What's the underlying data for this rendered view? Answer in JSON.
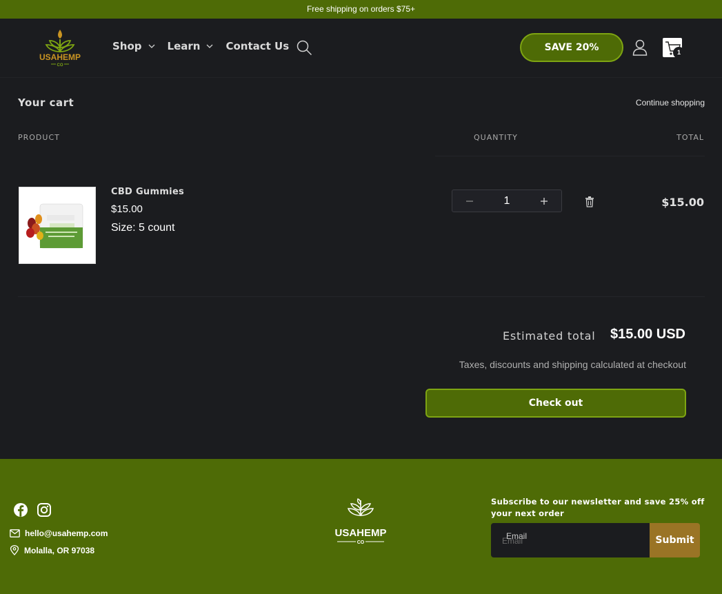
{
  "announcement": {
    "text": "Free shipping on orders $75+"
  },
  "header": {
    "logo_text": "USAHEMP",
    "logo_sub": "CO",
    "nav": [
      {
        "label": "Shop",
        "has_dropdown": true
      },
      {
        "label": "Learn",
        "has_dropdown": true
      },
      {
        "label": "Contact Us",
        "has_dropdown": false
      }
    ],
    "search_icon": "search-icon",
    "save_label": "SAVE 20%",
    "account_icon": "user-icon",
    "cart_icon": "cart-icon",
    "cart_count": "1"
  },
  "cart": {
    "title": "Your cart",
    "continue_label": "Continue shopping",
    "columns": {
      "product": "PRODUCT",
      "quantity": "QUANTITY",
      "total": "TOTAL"
    },
    "items": [
      {
        "name": "CBD Gummies",
        "price": "$15.00",
        "size": "Size: 5 count",
        "quantity": "1",
        "line_total": "$15.00"
      }
    ],
    "estimated_label": "Estimated total",
    "estimated_value": "$15.00 USD",
    "tax_note": "Taxes, discounts and shipping calculated at checkout",
    "checkout_label": "Check out"
  },
  "footer": {
    "email": "hello@usahemp.com",
    "location": "Molalla, OR 97038",
    "logo_text": "USAHEMP",
    "logo_sub": "CO",
    "newsletter_title": "Subscribe to our newsletter and save 25% off your next order",
    "email_label": "Email",
    "email_placeholder": "Email",
    "submit_label": "Submit"
  },
  "colors": {
    "brand_green": "#4e6b06",
    "accent_green_border": "#7ea512",
    "background": "#1b1c1f",
    "submit_gold": "#9a7425"
  }
}
